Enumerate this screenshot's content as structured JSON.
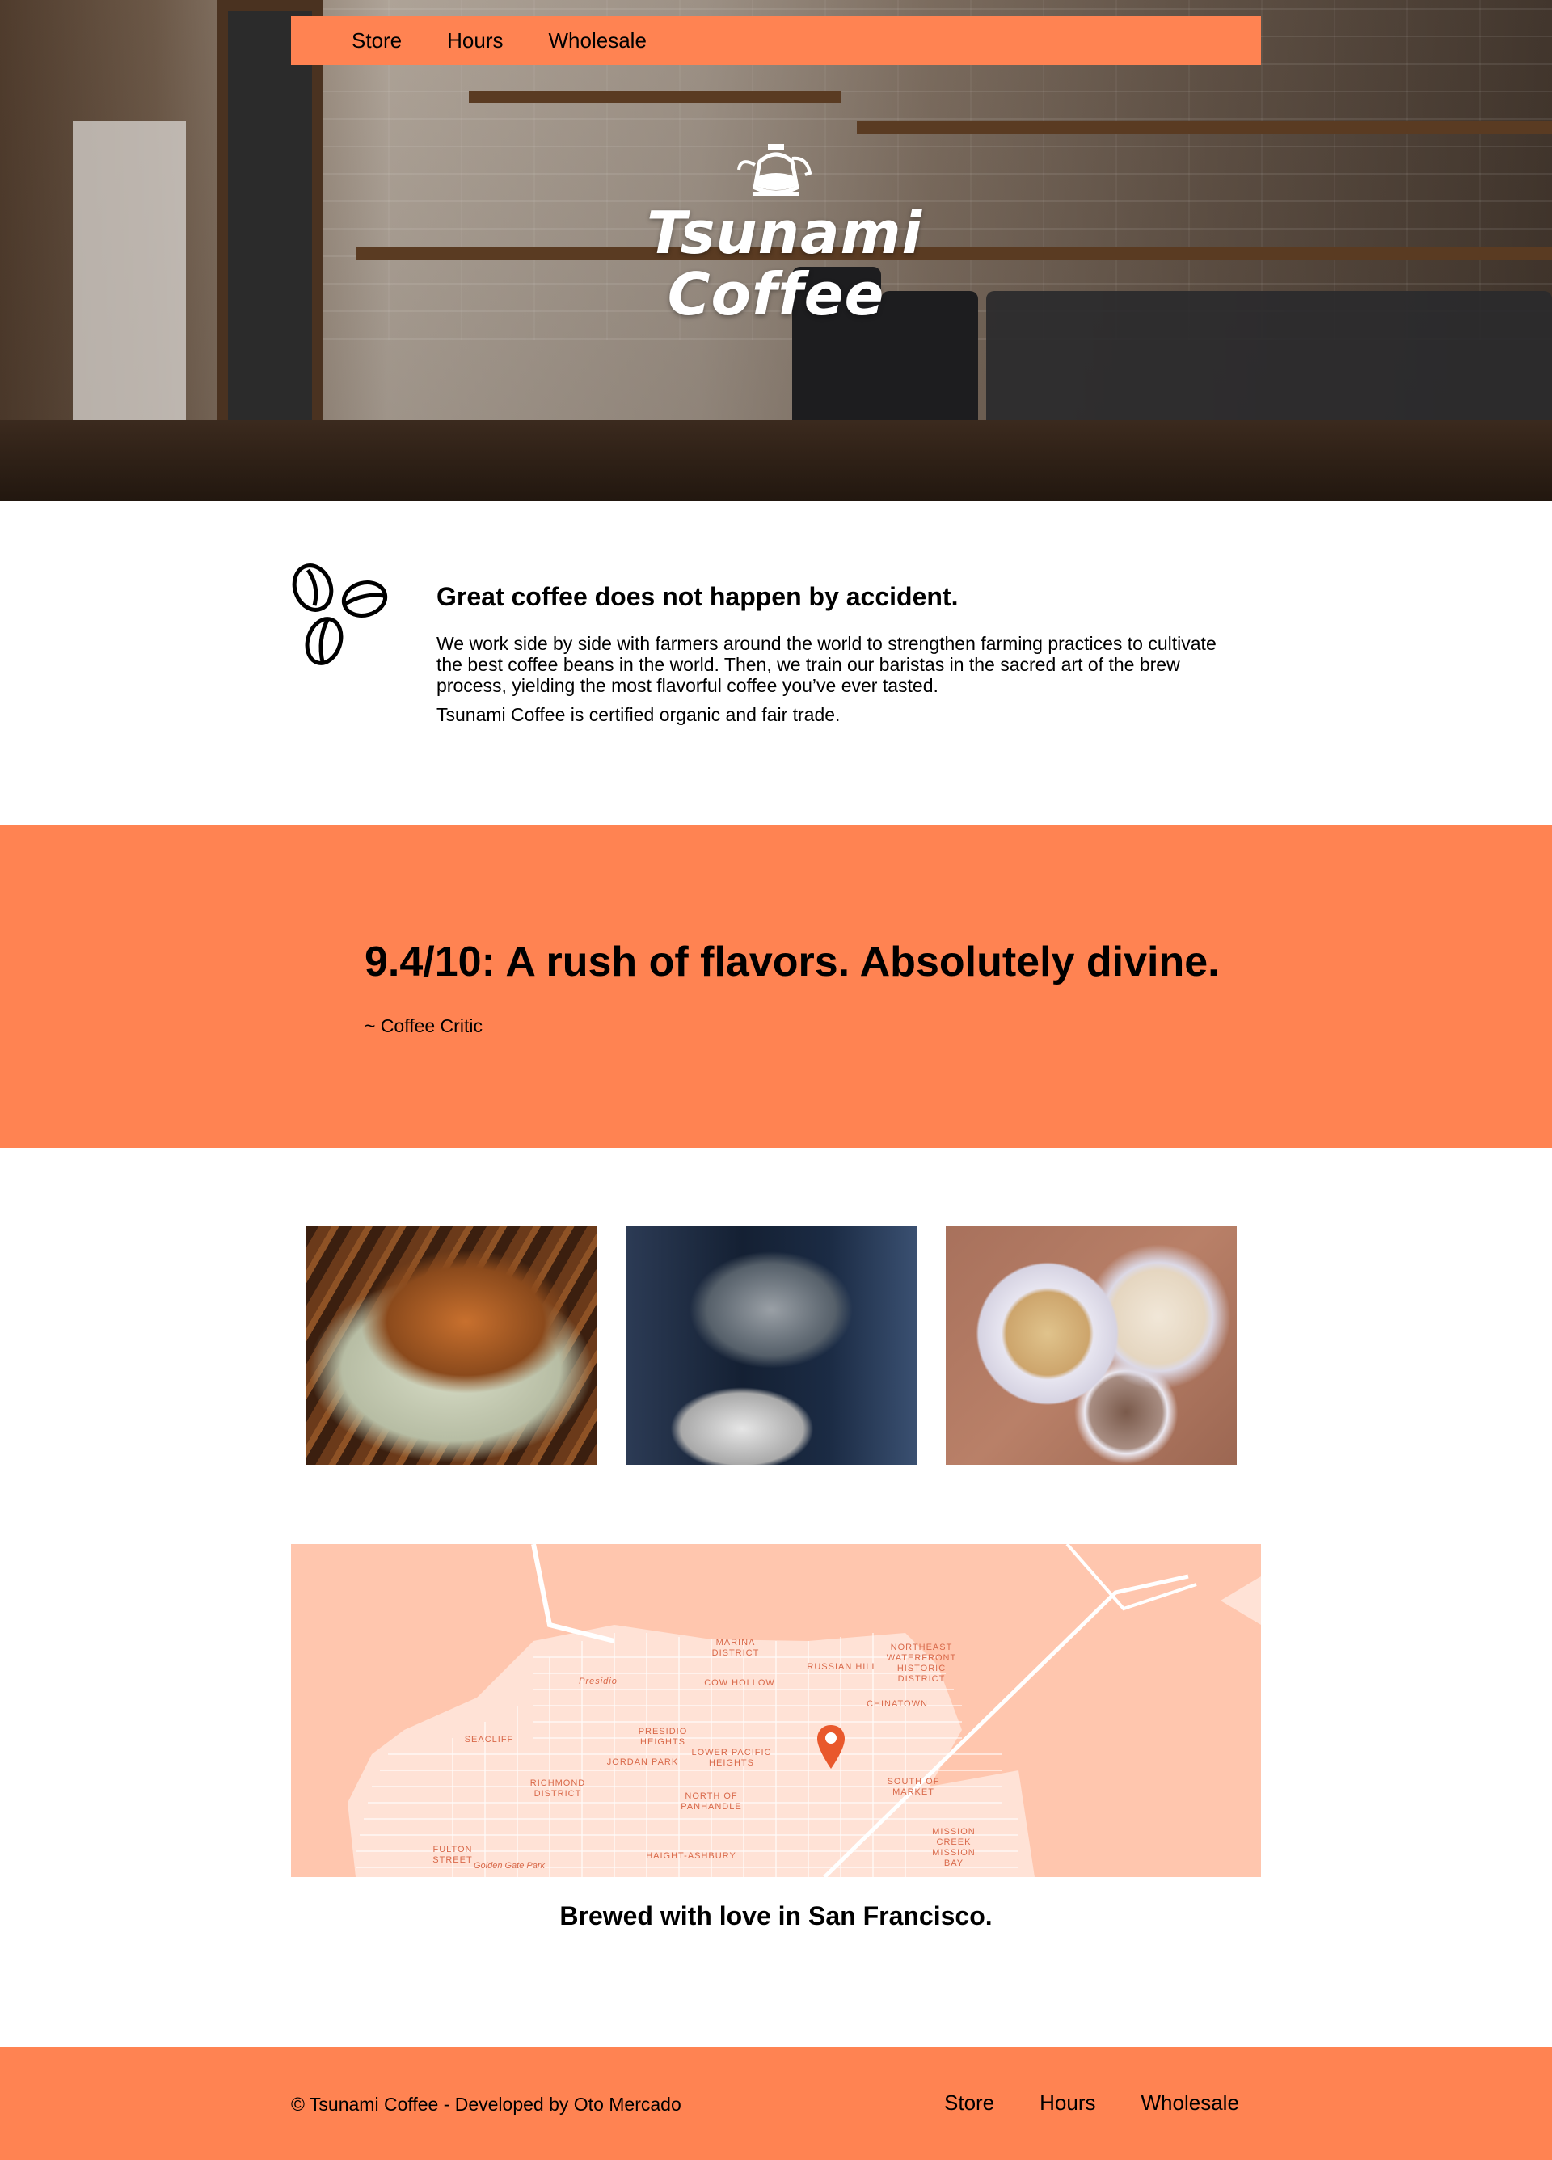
{
  "nav": {
    "items": [
      "Store",
      "Hours",
      "Wholesale"
    ]
  },
  "hero": {
    "logo_line1": "Tsunami",
    "logo_line2": "Coffee"
  },
  "intro": {
    "heading": "Great coffee does not happen by accident.",
    "paragraph1": "We work side by side with farmers around the world to strengthen farming practices to cultivate the best coffee beans in the world. Then, we train our baristas in the sacred art of the brew process, yielding the most flavorful coffee you’ve ever tasted.",
    "paragraph2": "Tsunami Coffee is certified organic and fair trade."
  },
  "review": {
    "quote": "9.4/10: A rush of flavors. Absolutely divine.",
    "critic": "~ Coffee Critic"
  },
  "map": {
    "labels": [
      "MARINA DISTRICT",
      "NORTHEAST WATERFRONT HISTORIC DISTRICT",
      "RUSSIAN HILL",
      "Presidio",
      "COW HOLLOW",
      "CHINATOWN",
      "SEACLIFF",
      "PRESIDIO HEIGHTS",
      "LOWER PACIFIC HEIGHTS",
      "JORDAN PARK",
      "RICHMOND DISTRICT",
      "SOUTH OF MARKET",
      "NORTH OF PANHANDLE",
      "MISSION CREEK",
      "MISSION BAY",
      "HAIGHT-ASHBURY",
      "Golden Gate Park",
      "FULTON STREET"
    ],
    "accent_color": "#e9582c"
  },
  "location": {
    "caption": "Brewed with love in San Francisco."
  },
  "footer": {
    "copyright": "© Tsunami Coffee - Developed by Oto Mercado",
    "nav": [
      "Store",
      "Hours",
      "Wholesale"
    ]
  },
  "colors": {
    "brand": "#ff8352",
    "map_background": "#ffc6ae"
  }
}
